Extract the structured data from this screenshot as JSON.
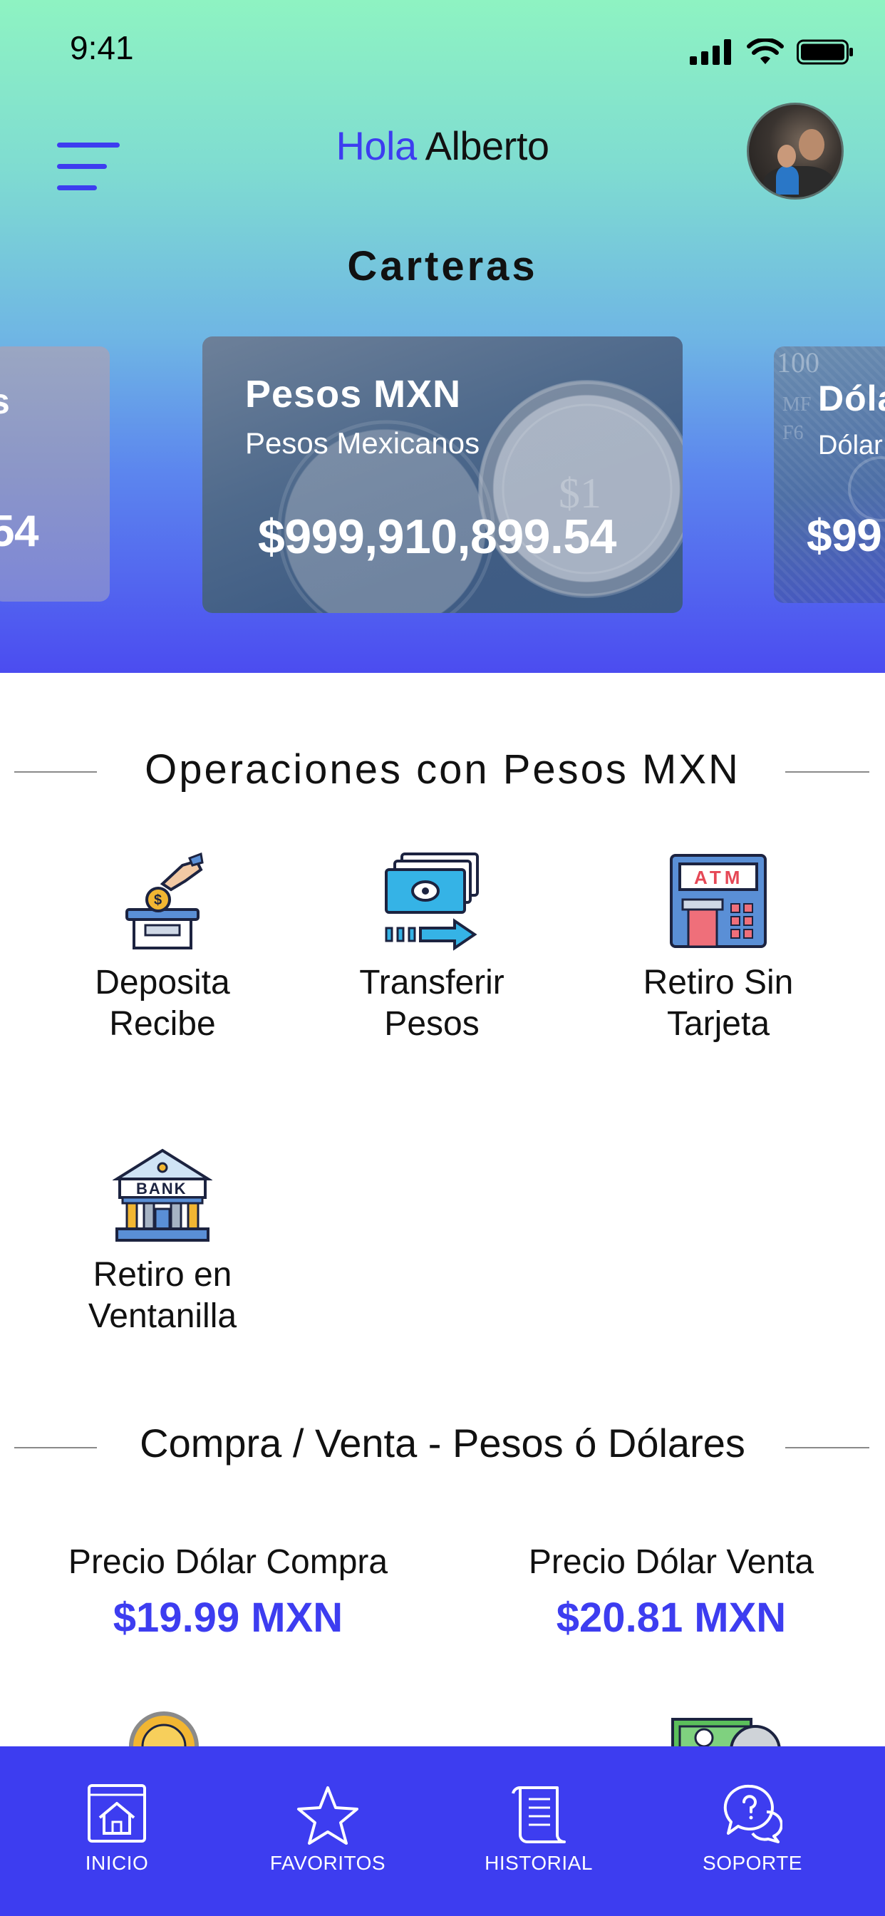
{
  "status_bar": {
    "time": "9:41"
  },
  "header": {
    "greeting_prefix": "Hola",
    "user_name": "Alberto"
  },
  "wallets": {
    "title": "Carteras",
    "cards": [
      {
        "id": "left",
        "title": "s",
        "subtitle": "",
        "amount": "54"
      },
      {
        "id": "main",
        "title": "Pesos MXN",
        "subtitle": "Pesos Mexicanos",
        "amount": "$999,910,899.54"
      },
      {
        "id": "right",
        "title": "Dóla",
        "subtitle": "Dólar",
        "amount": "$99"
      }
    ]
  },
  "operations": {
    "title": "Operaciones con Pesos MXN",
    "items": [
      {
        "line1": "Deposita",
        "line2": "Recibe",
        "icon": "deposit-icon"
      },
      {
        "line1": "Transferir",
        "line2": "Pesos",
        "icon": "transfer-icon"
      },
      {
        "line1": "Retiro Sin",
        "line2": "Tarjeta",
        "icon": "atm-icon",
        "icon_text": "ATM"
      },
      {
        "line1": "Retiro en",
        "line2": "Ventanilla",
        "icon": "bank-icon",
        "icon_text": "BANK"
      }
    ]
  },
  "exchange": {
    "title": "Compra / Venta - Pesos ó Dólares",
    "buy_label": "Precio Dólar Compra",
    "buy_value": "$19.99 MXN",
    "sell_label": "Precio Dólar Venta",
    "sell_value": "$20.81 MXN"
  },
  "bottom_nav": {
    "items": [
      {
        "label": "INICIO",
        "icon": "home-icon"
      },
      {
        "label": "FAVORITOS",
        "icon": "star-icon"
      },
      {
        "label": "HISTORIAL",
        "icon": "scroll-icon"
      },
      {
        "label": "SOPORTE",
        "icon": "support-icon"
      }
    ]
  },
  "colors": {
    "accent": "#3d3df0",
    "gradient_top": "#8ef3c2",
    "gradient_bottom": "#4b4cf0"
  }
}
